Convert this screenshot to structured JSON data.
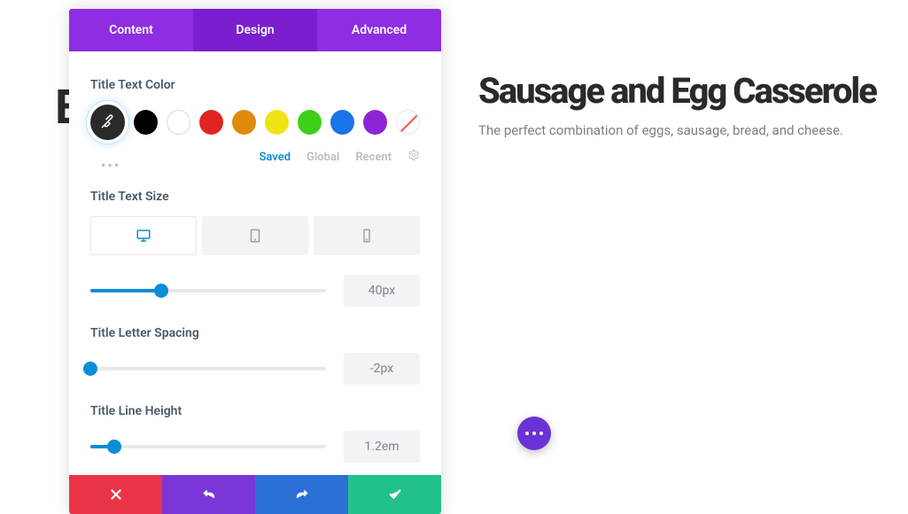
{
  "tabs": {
    "content": "Content",
    "design": "Design",
    "advanced": "Advanced"
  },
  "sections": {
    "title_color": {
      "label": "Title Text Color"
    },
    "title_size": {
      "label": "Title Text Size",
      "value": "40px",
      "fill_pct": 30
    },
    "letter_sp": {
      "label": "Title Letter Spacing",
      "value": "-2px",
      "fill_pct": 0
    },
    "line_h": {
      "label": "Title Line Height",
      "value": "1.2em",
      "fill_pct": 10
    }
  },
  "palette_tabs": {
    "saved": "Saved",
    "global": "Global",
    "recent": "Recent"
  },
  "swatches": {
    "black": "#000000",
    "red": "#e02424",
    "orange": "#e08a0c",
    "yellow": "#f0e314",
    "green": "#3ecf1a",
    "blue": "#1a73e8",
    "purple": "#8e24d6"
  },
  "preview": {
    "title": "Sausage and Egg Casserole",
    "subtitle": "The perfect combination of eggs, sausage, bread, and cheese."
  }
}
